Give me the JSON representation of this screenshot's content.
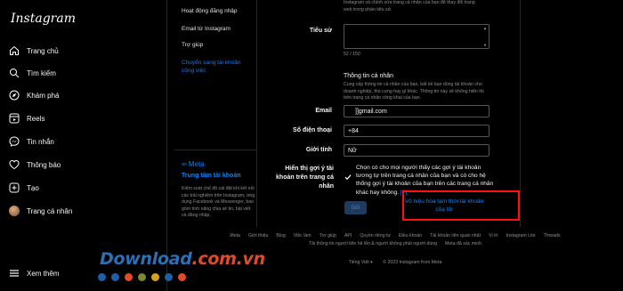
{
  "app": {
    "logo": "Instagram"
  },
  "nav": {
    "items": [
      {
        "label": "Trang chủ",
        "icon": "home-icon"
      },
      {
        "label": "Tìm kiếm",
        "icon": "search-icon"
      },
      {
        "label": "Khám phá",
        "icon": "compass-icon"
      },
      {
        "label": "Reels",
        "icon": "reels-icon"
      },
      {
        "label": "Tin nhắn",
        "icon": "messenger-icon"
      },
      {
        "label": "Thông báo",
        "icon": "heart-icon"
      },
      {
        "label": "Tạo",
        "icon": "plus-square-icon"
      },
      {
        "label": "Trang cá nhân",
        "icon": "avatar"
      }
    ],
    "more": "Xem thêm"
  },
  "settings_nav": {
    "items": [
      "Hoạt động đăng nhập",
      "Email từ Instagram",
      "Trợ giúp"
    ],
    "active": "Chuyển sang tài khoản công việc",
    "meta_logo": "∞ Meta",
    "accounts_center": "Trung tâm tài khoản",
    "accounts_desc": "Kiểm soát chế độ cài đặt khi kết nối các trải nghiệm trên Instagram, ứng dụng Facebook và Messenger, bao gồm tính năng chia sẻ tin, bài viết và đăng nhập."
  },
  "form": {
    "top_note_1": "Instagram và chính sửa trang cá nhân của bạn để thay đổi trang",
    "top_note_2": "web trong phần tiểu sử.",
    "bio_label": "Tiểu sử",
    "bio_count": "52 / 150",
    "personal_title": "Thông tin cá nhân",
    "personal_desc": "Cung cấp thông tin cá nhân của bạn, bất kể bạn dùng tài khoản cho doanh nghiệp, thú cưng hay gì khác. Thông tin này sẽ không hiển thị trên trang cá nhân công khai của bạn.",
    "email_label": "Email",
    "email_value": "]]gmail.com",
    "phone_label": "Số điện thoại",
    "phone_value": "+84",
    "gender_label": "Giới tính",
    "gender_value": "Nữ",
    "suggest_label": "Hiển thị gợi ý tài khoản trên trang cá nhân",
    "suggest_text": "Chọn có cho mọi người thấy các gợi ý tài khoản tương tự trên trang cá nhân của bạn và có cho hệ thống gợi ý tài khoản của bạn trên các trang cá nhân khác hay không.",
    "suggest_help": "[?]",
    "submit_label": "Gửi",
    "disable_link": "Vô hiệu hóa tạm thời tài khoản của tôi"
  },
  "footer": {
    "links": [
      "Meta",
      "Giới thiệu",
      "Blog",
      "Việc làm",
      "Trợ giúp",
      "API",
      "Quyền riêng tư",
      "Điều khoản",
      "Tài khoản liên quan nhất",
      "Vị trí",
      "Instagram Lite",
      "Threads",
      "Tải thông tin người liên hệ lên & người không phải người dùng",
      "Meta đã xác minh"
    ],
    "language": "Tiếng Việt ▾",
    "copyright": "© 2023 Instagram from Meta"
  },
  "watermark": {
    "text_a": "Download",
    "text_b": ".com.vn",
    "colors": [
      "#1f5fa8",
      "#1f5fa8",
      "#e14b2a",
      "#7a8b2a",
      "#d7a21e",
      "#1f5fa8",
      "#e14b2a"
    ]
  },
  "colors": {
    "accent": "#0a84ff",
    "highlight": "#ff1010",
    "background": "#000000"
  }
}
